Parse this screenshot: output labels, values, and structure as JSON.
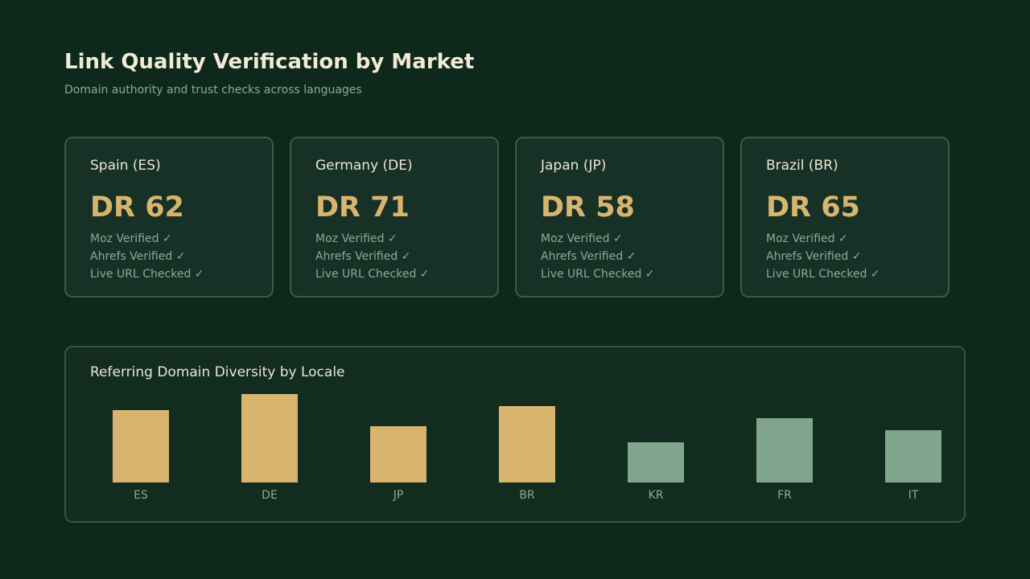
{
  "header": {
    "title": "Link Quality Verification by Market",
    "subtitle": "Domain authority and trust checks across languages"
  },
  "markets": [
    {
      "name": "Spain (ES)",
      "dr": "DR 62",
      "checks": [
        "Moz Verified ✓",
        "Ahrefs Verified ✓",
        "Live URL Checked ✓"
      ]
    },
    {
      "name": "Germany (DE)",
      "dr": "DR 71",
      "checks": [
        "Moz Verified ✓",
        "Ahrefs Verified ✓",
        "Live URL Checked ✓"
      ]
    },
    {
      "name": "Japan (JP)",
      "dr": "DR 58",
      "checks": [
        "Moz Verified ✓",
        "Ahrefs Verified ✓",
        "Live URL Checked ✓"
      ]
    },
    {
      "name": "Brazil (BR)",
      "dr": "DR 65",
      "checks": [
        "Moz Verified ✓",
        "Ahrefs Verified ✓",
        "Live URL Checked ✓"
      ]
    }
  ],
  "chart_title": "Referring Domain Diversity by Locale",
  "colors": {
    "highlight": "#d8b56f",
    "muted": "#80a58c"
  },
  "chart_data": {
    "type": "bar",
    "title": "",
    "xlabel": "",
    "ylabel": "",
    "categories": [
      "ES",
      "DE",
      "JP",
      "BR",
      "KR",
      "FR",
      "IT"
    ],
    "values": [
      90,
      110,
      70,
      95,
      50,
      80,
      65
    ],
    "highlighted": [
      true,
      true,
      true,
      true,
      false,
      false,
      false
    ],
    "ylim": [
      0,
      110
    ],
    "grid": false
  }
}
